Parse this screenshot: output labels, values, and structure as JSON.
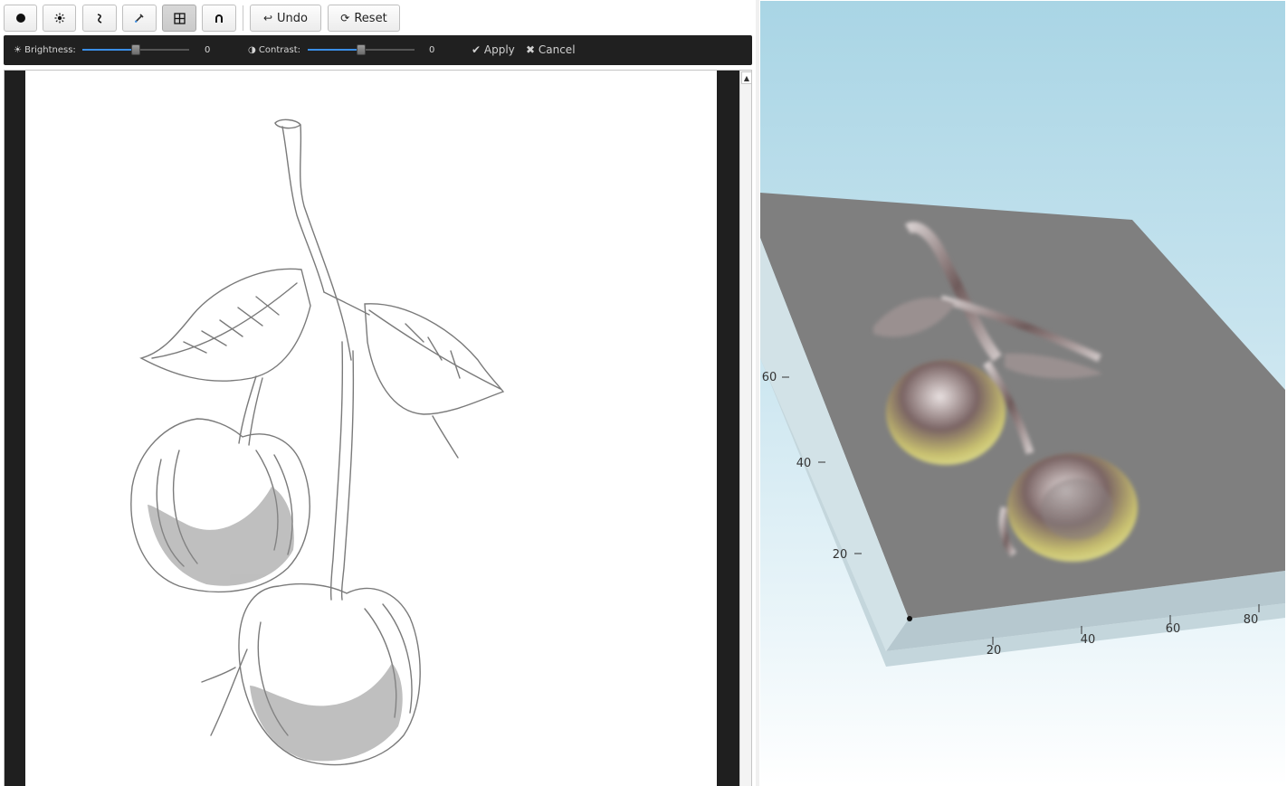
{
  "toolbar": {
    "tools": [
      {
        "name": "circle-tool",
        "icon": "filled-circle-icon",
        "active": false
      },
      {
        "name": "brightness-tool",
        "icon": "sun-icon",
        "active": false
      },
      {
        "name": "curve-tool",
        "icon": "curve-icon",
        "active": false
      },
      {
        "name": "pipette-tool",
        "icon": "eyedropper-icon",
        "active": false
      },
      {
        "name": "grid-tool",
        "icon": "grid-icon",
        "active": true
      },
      {
        "name": "magnet-tool",
        "icon": "magnet-icon",
        "active": false
      }
    ],
    "undo_label": "Undo",
    "undo_glyph": "↩",
    "reset_label": "Reset",
    "reset_glyph": "⟳"
  },
  "adjust": {
    "brightness_label": "☀ Brightness:",
    "brightness_value": "0",
    "brightness_level": 0.5,
    "contrast_label": "◑ Contrast:",
    "contrast_value": "0",
    "contrast_level": 0.5,
    "apply_label": "✔ Apply",
    "cancel_label": "✖ Cancel"
  },
  "scene": {
    "axis_labels": [
      "20",
      "40",
      "60",
      "80",
      "20",
      "40",
      "60"
    ],
    "colors": {
      "plate_top": "#7f7f7f",
      "plate_side": "#b8c8cf",
      "slider_fill": "#3a8ee6"
    }
  }
}
